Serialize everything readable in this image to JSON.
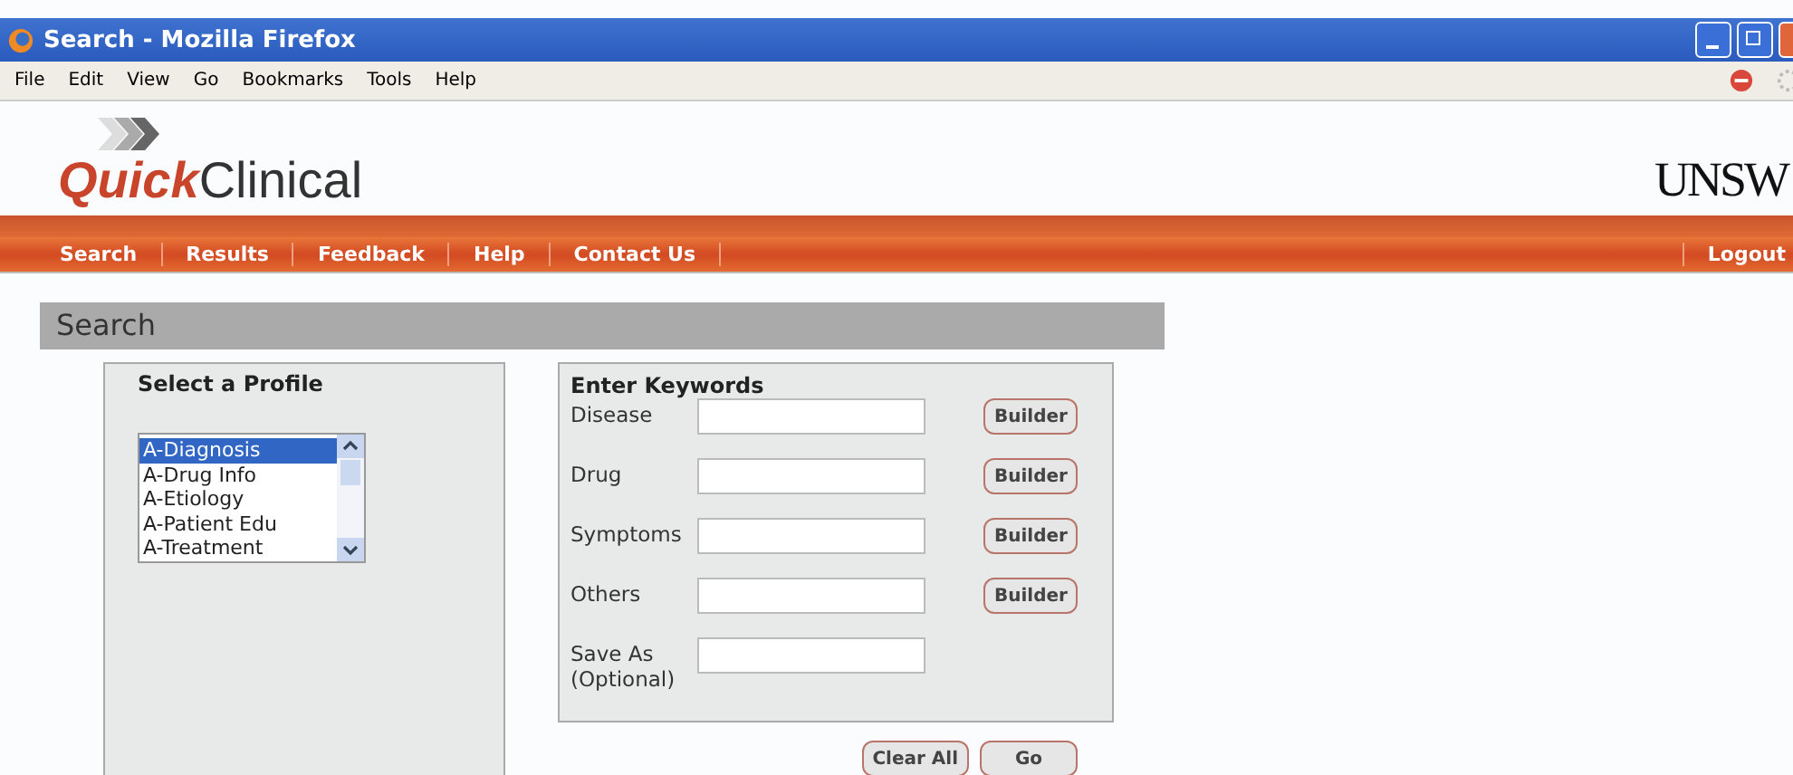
{
  "window": {
    "title": "Search - Mozilla Firefox"
  },
  "menu": [
    "File",
    "Edit",
    "View",
    "Go",
    "Bookmarks",
    "Tools",
    "Help"
  ],
  "logo": {
    "bold": "Quick",
    "light": "Clinical"
  },
  "university": "UNSW",
  "nav": [
    "Search",
    "Results",
    "Feedback",
    "Help",
    "Contact Us"
  ],
  "logout": "Logout",
  "panel": {
    "title": "Search"
  },
  "profile": {
    "heading": "Select a Profile",
    "items": [
      {
        "label": "A-Diagnosis",
        "selected": true
      },
      {
        "label": "A-Drug Info",
        "selected": false
      },
      {
        "label": "A-Etiology",
        "selected": false
      },
      {
        "label": "A-Patient Edu",
        "selected": false
      },
      {
        "label": "A-Treatment",
        "selected": false
      }
    ]
  },
  "keywords": {
    "heading": "Enter Keywords",
    "fields": [
      {
        "label": "Disease",
        "button": "Builder"
      },
      {
        "label": "Drug",
        "button": "Builder"
      },
      {
        "label": "Symptoms",
        "button": "Builder"
      },
      {
        "label": "Others",
        "button": "Builder"
      },
      {
        "label": "Save As (Optional)"
      }
    ]
  },
  "actions": [
    "Clear All",
    "Go"
  ]
}
